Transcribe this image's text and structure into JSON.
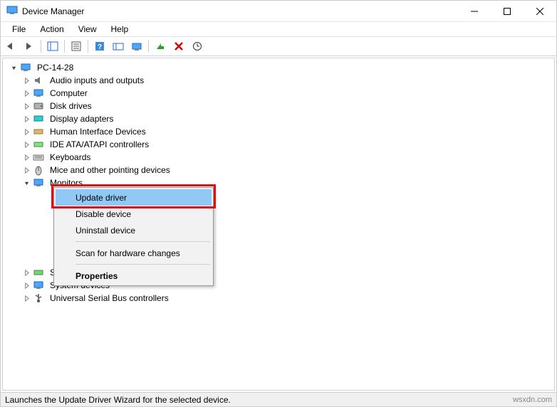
{
  "window": {
    "title": "Device Manager"
  },
  "menu": {
    "items": [
      "File",
      "Action",
      "View",
      "Help"
    ]
  },
  "tree": {
    "root": "PC-14-28",
    "categories": [
      "Audio inputs and outputs",
      "Computer",
      "Disk drives",
      "Display adapters",
      "Human Interface Devices",
      "IDE ATA/ATAPI controllers",
      "Keyboards",
      "Mice and other pointing devices",
      "Monitors",
      "Storage controllers",
      "System devices",
      "Universal Serial Bus controllers"
    ]
  },
  "context_menu": {
    "items": [
      "Update driver",
      "Disable device",
      "Uninstall device",
      "Scan for hardware changes",
      "Properties"
    ]
  },
  "statusbar": {
    "text": "Launches the Update Driver Wizard for the selected device."
  },
  "watermark": "wsxdn.com"
}
